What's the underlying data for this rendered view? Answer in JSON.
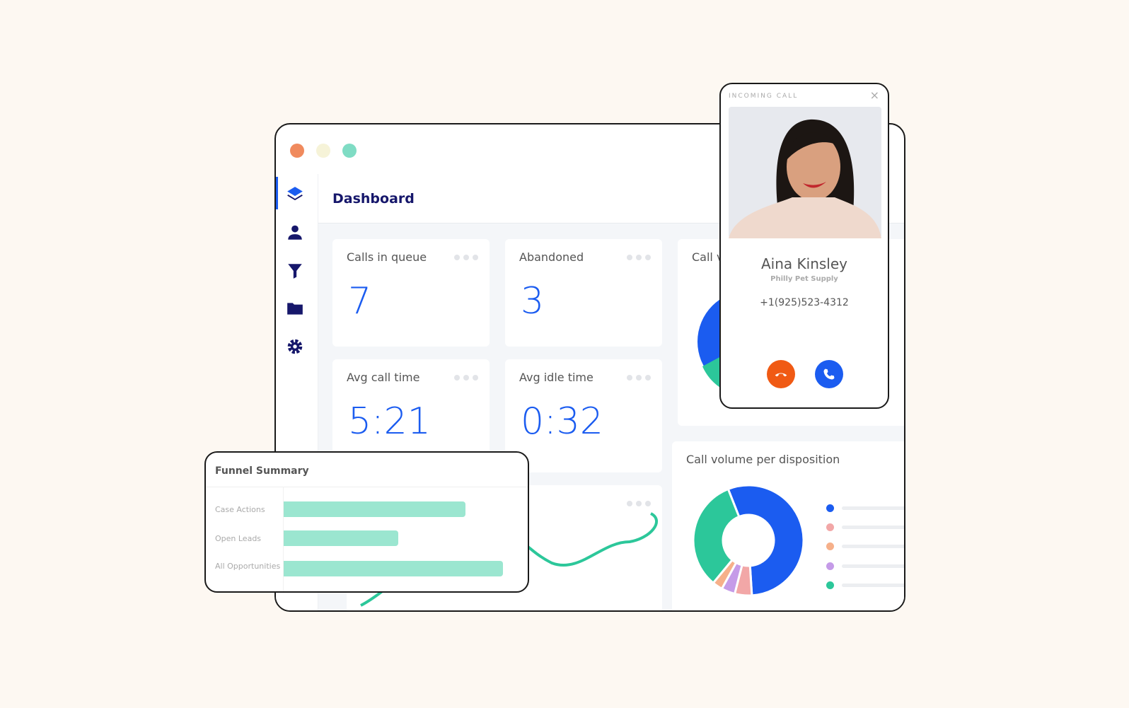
{
  "window": {
    "controls": [
      {
        "name": "close",
        "color": "#f08a5d"
      },
      {
        "name": "minimize",
        "color": "#f6f3d8"
      },
      {
        "name": "maximize",
        "color": "#7fdcc4"
      }
    ]
  },
  "sidebar": {
    "items": [
      {
        "icon": "layers-icon",
        "active": true
      },
      {
        "icon": "user-icon"
      },
      {
        "icon": "filter-icon"
      },
      {
        "icon": "folder-icon"
      },
      {
        "icon": "gear-icon"
      }
    ]
  },
  "header": {
    "title": "Dashboard"
  },
  "stats": [
    {
      "label": "Calls in queue",
      "value": "7"
    },
    {
      "label": "Abandoned",
      "value": "3"
    },
    {
      "label": "Avg call time",
      "value": "5:21"
    },
    {
      "label": "Avg idle time",
      "value": "0:32"
    }
  ],
  "call_volume_card": {
    "label": "Call v"
  },
  "disposition_card": {
    "label": "Call volume per disposition"
  },
  "chart_data": [
    {
      "type": "pie",
      "title": "Call volume per disposition",
      "values": [
        55,
        5,
        4,
        3,
        33
      ],
      "colors": [
        "#1b5cf0",
        "#f2a7a7",
        "#c59be8",
        "#f6b08a",
        "#2cc79a"
      ]
    },
    {
      "type": "bar",
      "title": "Funnel Summary",
      "categories": [
        "Case Actions",
        "Open Leads",
        "All Opportunities"
      ],
      "values": [
        78,
        49,
        94
      ],
      "color": "#9be6d0"
    }
  ],
  "funnel": {
    "title": "Funnel Summary"
  },
  "incoming_call": {
    "heading": "INCOMING CALL",
    "name": "Aina Kinsley",
    "company": "Philly Pet Supply",
    "phone": "+1(925)523-4312",
    "decline_color": "#f05a14",
    "accept_color": "#1b5cf0"
  }
}
